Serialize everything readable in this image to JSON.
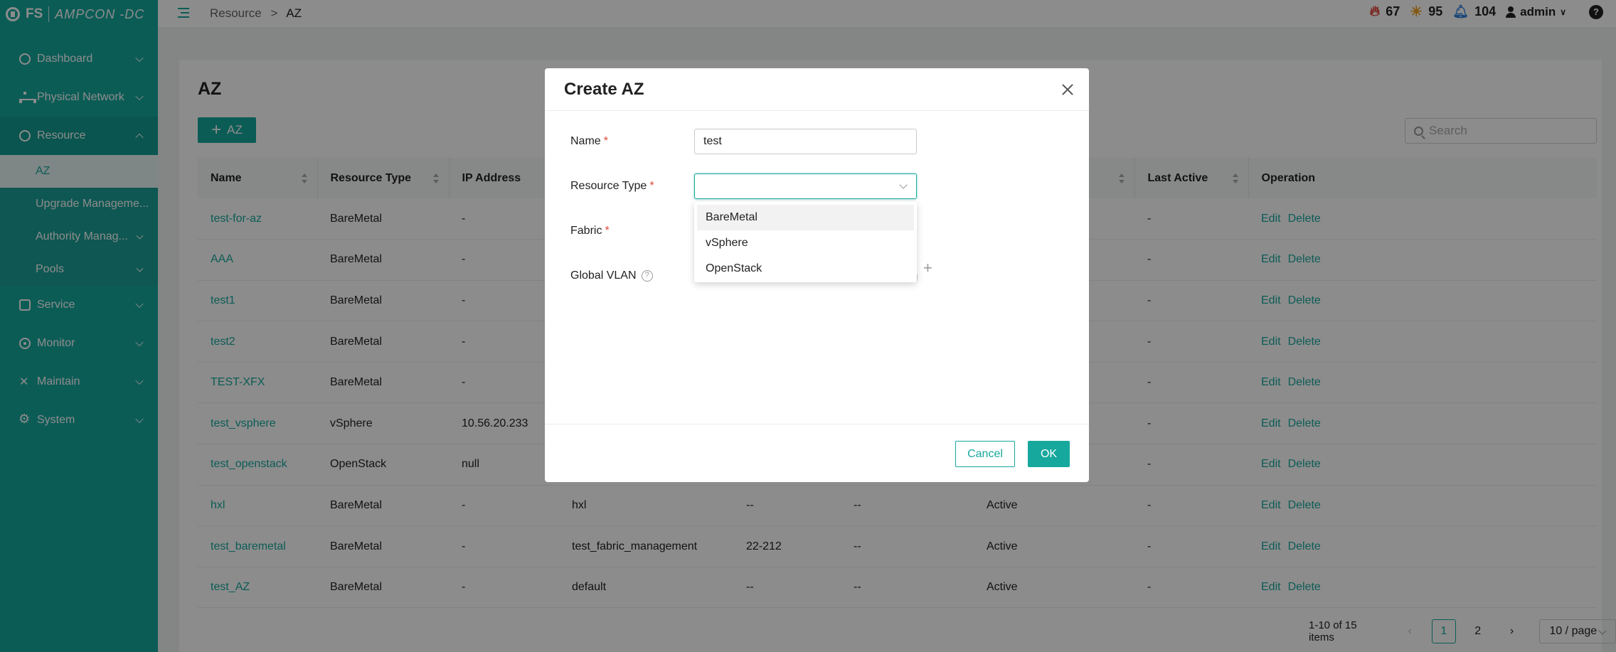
{
  "brand": {
    "logo": "FS",
    "product": "AMPCON -DC"
  },
  "sidebar": {
    "items": [
      {
        "label": "Dashboard"
      },
      {
        "label": "Physical Network"
      },
      {
        "label": "Resource"
      },
      {
        "label": "Service"
      },
      {
        "label": "Monitor"
      },
      {
        "label": "Maintain"
      },
      {
        "label": "System"
      }
    ],
    "resource_sub": [
      {
        "label": "AZ"
      },
      {
        "label": "Upgrade Manageme..."
      },
      {
        "label": "Authority Manag..."
      },
      {
        "label": "Pools"
      }
    ]
  },
  "topbar": {
    "breadcrumb_parent": "Resource",
    "breadcrumb_sep": ">",
    "breadcrumb_current": "AZ",
    "alerts_critical": "67",
    "alerts_warning": "95",
    "notifications": "104",
    "user": "admin",
    "help": "?"
  },
  "page": {
    "title": "AZ",
    "add_label": "AZ",
    "search_placeholder": "Search"
  },
  "table": {
    "headers": [
      "Name",
      "Resource Type",
      "IP Address",
      "",
      "",
      "",
      "",
      "Last Active",
      "Operation"
    ],
    "rows": [
      {
        "name": "test-for-az",
        "type": "BareMetal",
        "ip": "-",
        "c4": "",
        "c5": "",
        "c6": "",
        "c7": "",
        "last": "-"
      },
      {
        "name": "AAA",
        "type": "BareMetal",
        "ip": "-",
        "c4": "",
        "c5": "",
        "c6": "",
        "c7": "",
        "last": "-"
      },
      {
        "name": "test1",
        "type": "BareMetal",
        "ip": "-",
        "c4": "",
        "c5": "",
        "c6": "",
        "c7": "",
        "last": "-"
      },
      {
        "name": "test2",
        "type": "BareMetal",
        "ip": "-",
        "c4": "",
        "c5": "",
        "c6": "",
        "c7": "",
        "last": "-"
      },
      {
        "name": "TEST-XFX",
        "type": "BareMetal",
        "ip": "-",
        "c4": "",
        "c5": "",
        "c6": "",
        "c7": "",
        "last": "-"
      },
      {
        "name": "test_vsphere",
        "type": "vSphere",
        "ip": "10.56.20.233",
        "c4": "",
        "c5": "",
        "c6": "",
        "c7": "",
        "last": "-"
      },
      {
        "name": "test_openstack",
        "type": "OpenStack",
        "ip": "null",
        "c4": "",
        "c5": "",
        "c6": "",
        "c7": "",
        "last": "-"
      },
      {
        "name": "hxl",
        "type": "BareMetal",
        "ip": "-",
        "c4": "hxl",
        "c5": "--",
        "c6": "--",
        "c7": "Active",
        "last": "-"
      },
      {
        "name": "test_baremetal",
        "type": "BareMetal",
        "ip": "-",
        "c4": "test_fabric_management",
        "c5": "22-212",
        "c6": "--",
        "c7": "Active",
        "last": "-"
      },
      {
        "name": "test_AZ",
        "type": "BareMetal",
        "ip": "-",
        "c4": "default",
        "c5": "--",
        "c6": "--",
        "c7": "Active",
        "last": "-"
      }
    ],
    "edit_label": "Edit",
    "delete_label": "Delete"
  },
  "pagination": {
    "summary": "1-10 of 15 items",
    "pages": [
      "1",
      "2"
    ],
    "current": "1",
    "page_size": "10 / page"
  },
  "modal": {
    "title": "Create AZ",
    "name_label": "Name",
    "name_value": "test",
    "resource_type_label": "Resource Type",
    "resource_type_value": "",
    "fabric_label": "Fabric",
    "global_vlan_label": "Global VLAN",
    "required_mark": "*",
    "options": [
      "BareMetal",
      "vSphere",
      "OpenStack"
    ],
    "cancel_label": "Cancel",
    "ok_label": "OK"
  }
}
